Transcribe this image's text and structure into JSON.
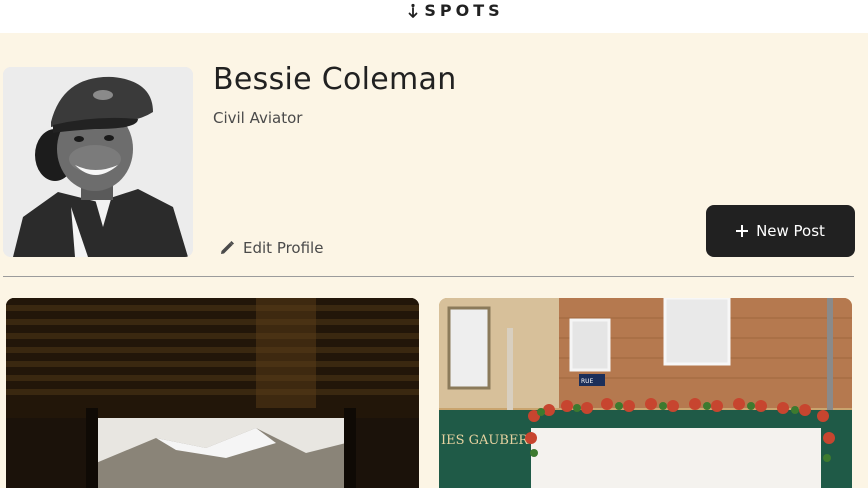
{
  "header": {
    "logo_text": "SPOTS",
    "logo_icon": "arrow-down-icon"
  },
  "profile": {
    "name": "Bessie Coleman",
    "description": "Civil Aviator",
    "edit_label": "Edit Profile",
    "edit_icon": "pencil-icon",
    "new_post_label": "New Post",
    "new_post_icon": "plus-icon"
  },
  "cards": {
    "sign_text": "IES GAUBERT",
    "street_sign": "RUE"
  },
  "colors": {
    "background": "#fcf5e5",
    "text": "#212121",
    "button": "#212121",
    "divider": "#9b9b9b"
  }
}
